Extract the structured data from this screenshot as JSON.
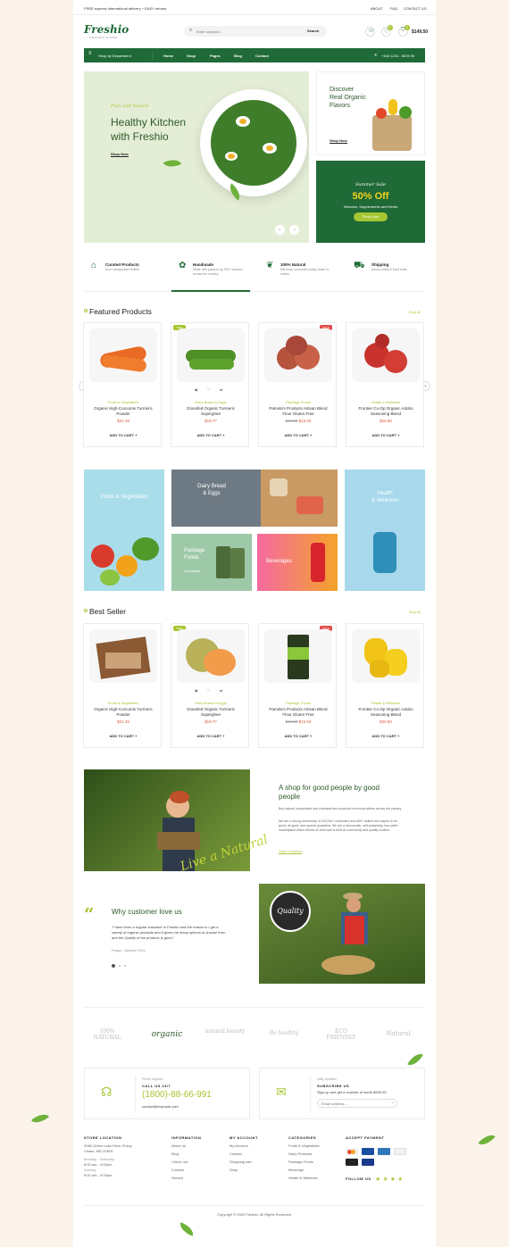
{
  "topbar": {
    "promo": "FREE express international delivery + EASY returns",
    "links": [
      "ABOUT",
      "FAQ",
      "CONTACT US"
    ]
  },
  "header": {
    "logo": "Freshio",
    "logo_sub": "ORGANIC STORE",
    "search_placeholder": "Enter keyword...",
    "search_button": "Search",
    "wishlist_count": "0",
    "cart_count": "0",
    "cart_total": "$149.50"
  },
  "nav": {
    "department": "Shop by Department",
    "items": [
      "Home",
      "Shop",
      "Pages",
      "Blog",
      "Contact"
    ],
    "phone": "+164 1234 - 5678 90"
  },
  "hero": {
    "script": "Pure and Nature",
    "title1": "Healthy Kitchen",
    "title2": "with Freshio",
    "cta": "Shop Now"
  },
  "promo1": {
    "line1": "Discover",
    "line2": "Real Organic",
    "line3": "Flavors",
    "cta": "Shop Now"
  },
  "promo2": {
    "script": "Summer Sale",
    "offer": "50% Off",
    "desc": "Vitamins, Supplements and Herbs",
    "cta": "Shop Now"
  },
  "features": [
    {
      "title": "Curated Products",
      "desc": "from Handpicked Sellers"
    },
    {
      "title": "Handmade",
      "desc": "Made with passion by 300+ curators across the country"
    },
    {
      "title": "100% Natural",
      "desc": "Eat local, consume locally closer to nature"
    },
    {
      "title": "Shipping",
      "desc": "Across West & East India"
    }
  ],
  "featured": {
    "title": "Featured Products",
    "shop_all": "Shop All",
    "products": [
      {
        "cat": "Fruits & Vegetables",
        "name": "Organic High-Curcumin Turmeric Powder",
        "price": "$22.49",
        "old": "",
        "badge": ""
      },
      {
        "cat": "Dairy Bread & Eggs",
        "name": "Grassfed Organic Turmeric Superghee",
        "price": "$19.77",
        "old": "",
        "badge": "NEW"
      },
      {
        "cat": "Package Foods",
        "name": "Pamela's Products Artisan Blend Flour Gluten Free",
        "price": "$15.50",
        "old": "$16.50",
        "badge": "SALE"
      },
      {
        "cat": "Health & Wellness",
        "name": "Frontier Co-Op Organic Adobo Seasoning Blend",
        "price": "$26.50",
        "old": "",
        "badge": ""
      }
    ]
  },
  "categories": {
    "fruits": "Fruits & Vegetables",
    "dairy1": "Dairy Bread",
    "dairy2": "& Eggs",
    "package1": "Package",
    "package2": "Foods",
    "package_count": "11 products",
    "beverages": "Beverages",
    "health1": "Health",
    "health2": "& Wellness"
  },
  "bestseller": {
    "title": "Best Seller",
    "shop_all": "Shop All",
    "products": [
      {
        "cat": "Fruits & Vegetables",
        "name": "Organic High-Curcumin Turmeric Powder",
        "price": "$22.49",
        "old": "",
        "badge": ""
      },
      {
        "cat": "Dairy Bread & Eggs",
        "name": "Grassfed Organic Turmeric Superghee",
        "price": "$19.77",
        "old": "",
        "badge": "NEW"
      },
      {
        "cat": "Package Foods",
        "name": "Pamela's Products Artisan Blend Flour Gluten Free",
        "price": "$15.50",
        "old": "$16.50",
        "badge": "SALE"
      },
      {
        "cat": "Health & Wellness",
        "name": "Frontier Co-Op Organic Adobo Seasoning Blend",
        "price": "$26.50",
        "old": "",
        "badge": ""
      }
    ]
  },
  "add_to_cart": "ADD TO CART",
  "about": {
    "title": "A shop for good people by good people",
    "p1": "Buy natural, sustainable and chemical-free products from local sellers across the country.",
    "p2": "We are a strong community of 100,000+ customers and 600+ sellers who aspire to be good, do good, and spread goodness. We are a democratic, self-sustaining, two-sided marketplace which thrives on trust and is built on community and quality content.",
    "link": "Store Location",
    "script": "Live a Natural"
  },
  "testimonial": {
    "title": "Why customer love us",
    "quote": "\"I have been a regular customer in Freshio and the reason is I get a variety of organic products and it gives me many options to choose from and the Quality of the produce is good.\"",
    "author": "Pragya - Bafandor Store",
    "badge": "Quality"
  },
  "brands": [
    "100% NATURAL",
    "organic",
    "natural beauty",
    "Be healthy",
    "ECO FRIENDLY",
    "Natural"
  ],
  "support": {
    "label": "Phone Support",
    "call": "CALL US 24/7",
    "phone": "(1800)-88-66-991",
    "email": "contact@example.com"
  },
  "newsletter": {
    "label": "Daily Updates",
    "title": "SUBSCRIBE US",
    "desc": "Sign up and get a voucher of worth $250.00",
    "placeholder": "Email address..."
  },
  "footer": {
    "store": {
      "head": "STORE LOCATION",
      "lines": [
        "9066 Green Lake Drive Chevy",
        "Chase, MD 20815",
        "Monday - Saturday",
        "8:00 am - 4:00pm",
        "Sunday",
        "8:00 am - 5:00pm"
      ]
    },
    "info": {
      "head": "INFORMATION",
      "items": [
        "About us",
        "Blog",
        "Check out",
        "Contact",
        "Service"
      ]
    },
    "account": {
      "head": "MY ACCOUNT",
      "items": [
        "My Account",
        "Contact",
        "Shopping cart",
        "Shop"
      ]
    },
    "cats": {
      "head": "CATEGORIES",
      "items": [
        "Fruits & Vegetables",
        "Dairy Products",
        "Package Foods",
        "Beverage",
        "Health & Wellness"
      ]
    },
    "payment": {
      "head": "ACCEPT PAYMENT",
      "follow": "FOLLOW US"
    },
    "copy": "Copyright © 2020 Freshio. All Rights Reserved."
  },
  "colors": {
    "primary": "#1f6a36",
    "accent": "#a6c631",
    "sale": "#e44b4b",
    "bg": "#fbf3ea"
  }
}
